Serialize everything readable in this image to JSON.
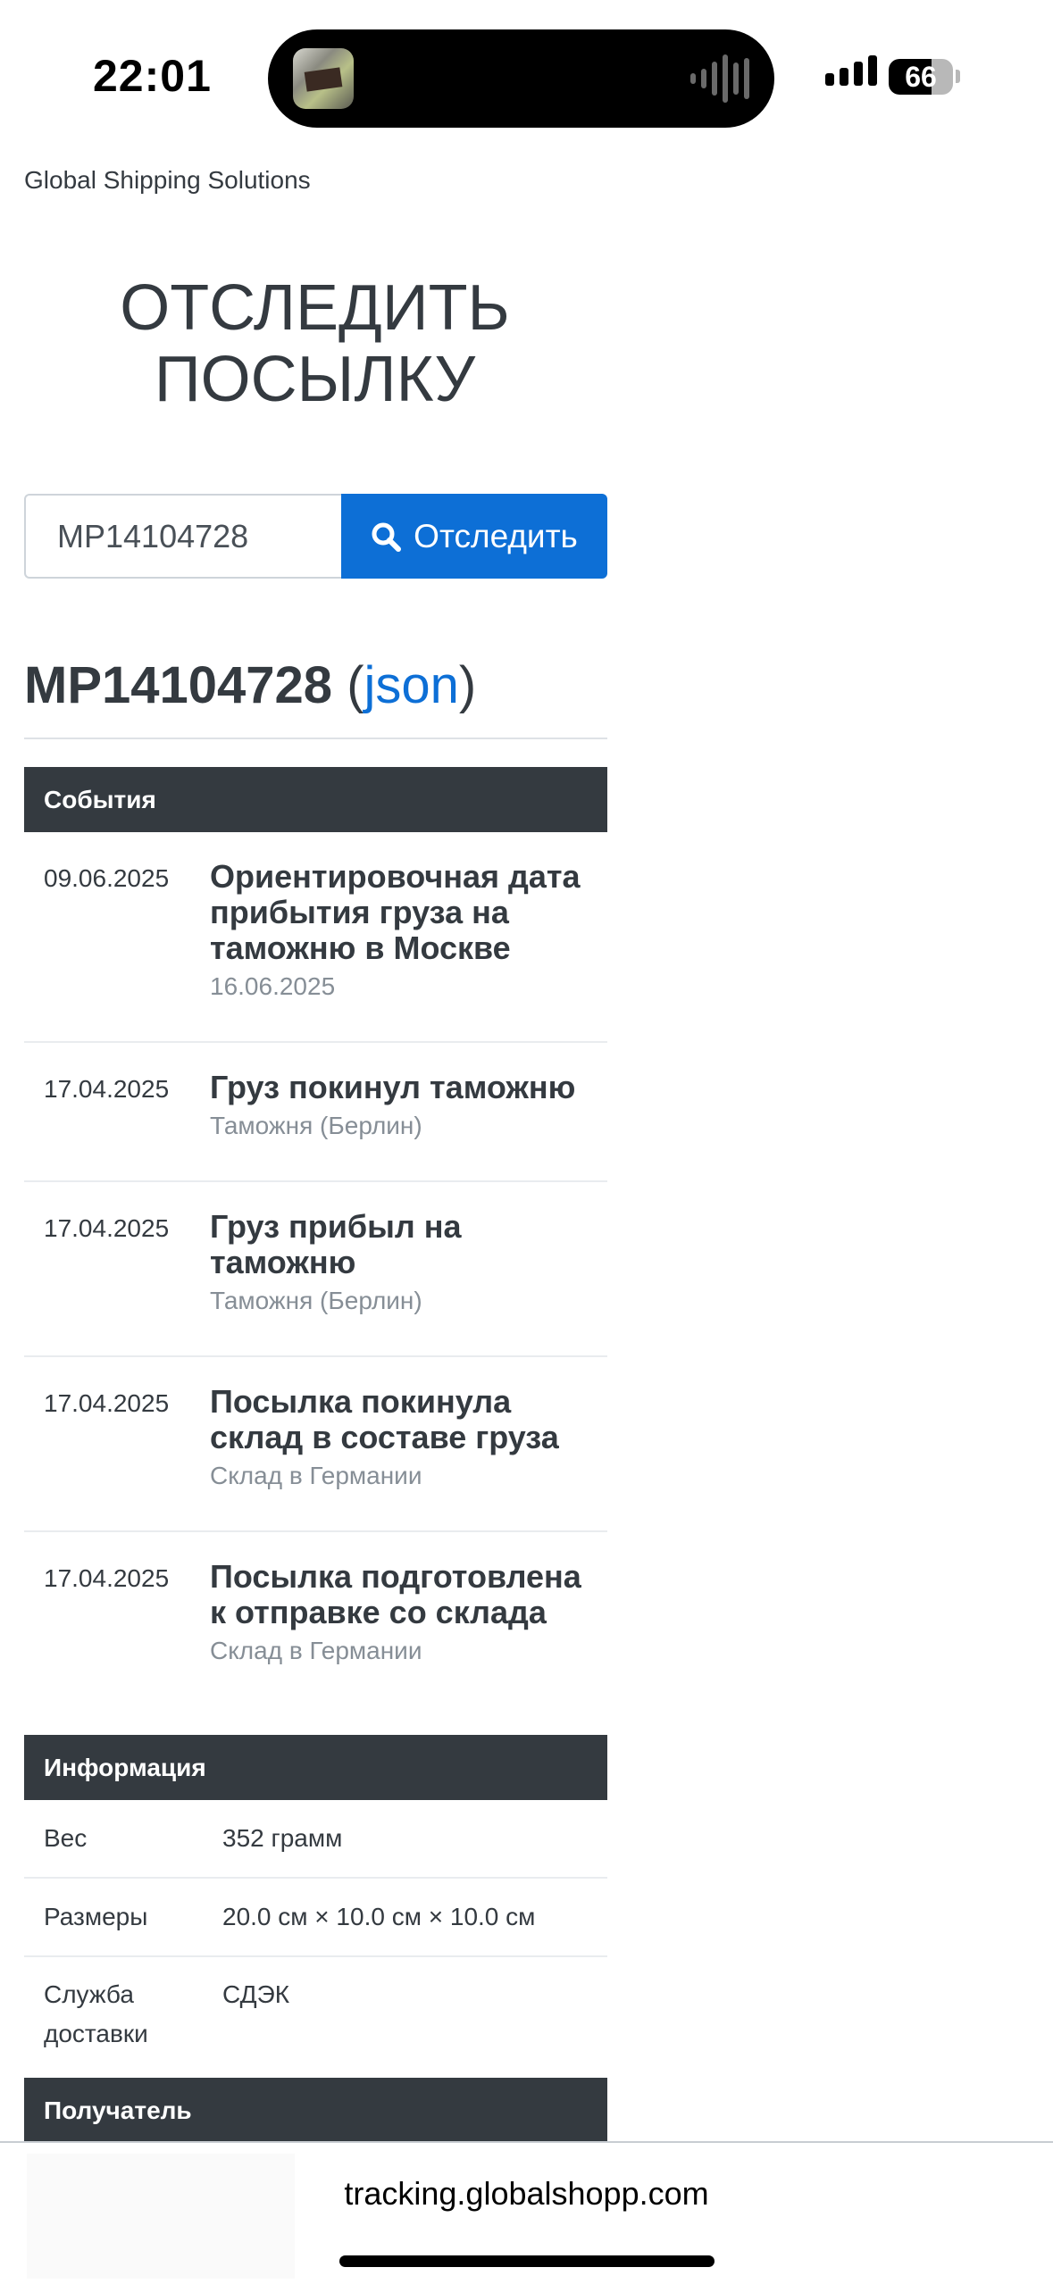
{
  "status_bar": {
    "time": "22:01",
    "battery": "66",
    "battery_level": 0.66,
    "signal_bars": 4
  },
  "brand": "Global Shipping Solutions",
  "page_title_line1": "ОТСЛЕДИТЬ",
  "page_title_line2": "ПОСЫЛКУ",
  "search": {
    "value": "MP14104728",
    "button_label": "Отследить",
    "button_icon": "search-icon"
  },
  "tracking": {
    "number": "MP14104728",
    "json_link": "json"
  },
  "events_header": "События",
  "events": [
    {
      "date": "09.06.2025",
      "title": "Ориентировочная дата прибытия груза на таможню в Москве",
      "sub": "16.06.2025"
    },
    {
      "date": "17.04.2025",
      "title": "Груз покинул таможню",
      "sub": "Таможня (Берлин)"
    },
    {
      "date": "17.04.2025",
      "title": "Груз прибыл на таможню",
      "sub": "Таможня (Берлин)"
    },
    {
      "date": "17.04.2025",
      "title": "Посылка покинула склад в составе груза",
      "sub": "Склад в Германии"
    },
    {
      "date": "17.04.2025",
      "title": "Посылка подготовлена к отправке со склада",
      "sub": "Склад в Германии"
    }
  ],
  "info_header": "Информация",
  "info": [
    {
      "label": "Вес",
      "value": "352 грамм"
    },
    {
      "label": "Размеры",
      "value": "20.0 см × 10.0 см × 10.0 см"
    },
    {
      "label": "Служба доставки",
      "value": "СДЭК"
    }
  ],
  "recipient_header": "Получатель",
  "browser": {
    "url": "tracking.globalshopp.com"
  },
  "colors": {
    "accent": "#0d6fd6",
    "dark_header": "#343a40",
    "muted_text": "#868e96"
  }
}
